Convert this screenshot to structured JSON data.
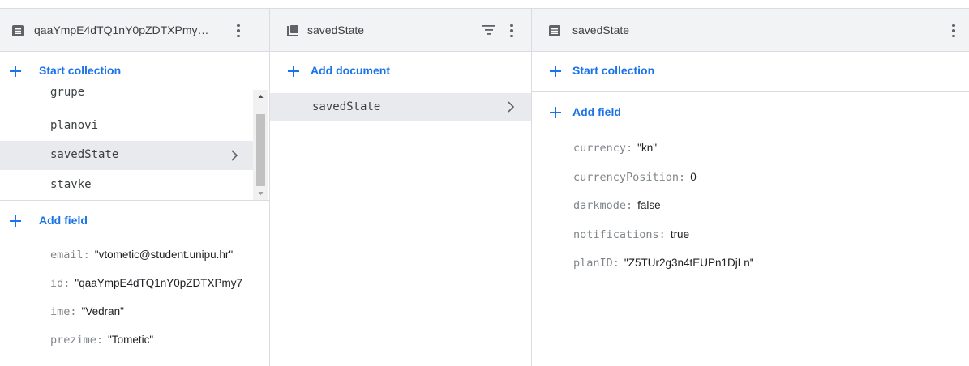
{
  "panel1": {
    "title": "qaaYmpE4dTQ1nY0pZDTXPmy…",
    "start_collection_label": "Start collection",
    "collections": [
      {
        "label": "grupe"
      },
      {
        "label": "planovi"
      },
      {
        "label": "savedState"
      },
      {
        "label": "stavke"
      }
    ],
    "add_field_label": "Add field",
    "fields": [
      {
        "key": "email",
        "value": "\"vtometic@student.unipu.hr\""
      },
      {
        "key": "id",
        "value": "\"qaaYmpE4dTQ1nY0pZDTXPmy7"
      },
      {
        "key": "ime",
        "value": "\"Vedran\""
      },
      {
        "key": "prezime",
        "value": "\"Tometic\""
      }
    ]
  },
  "panel2": {
    "title": "savedState",
    "add_document_label": "Add document",
    "documents": [
      {
        "label": "savedState"
      }
    ]
  },
  "panel3": {
    "title": "savedState",
    "start_collection_label": "Start collection",
    "add_field_label": "Add field",
    "fields": [
      {
        "key": "currency",
        "value": "\"kn\""
      },
      {
        "key": "currencyPosition",
        "value": "0"
      },
      {
        "key": "darkmode",
        "value": "false"
      },
      {
        "key": "notifications",
        "value": "true"
      },
      {
        "key": "planID",
        "value": "\"Z5TUr2g3n4tEUPn1DjLn\""
      }
    ]
  },
  "colors": {
    "accent": "#1a73e8",
    "header_bg": "#f1f3f4",
    "selected_bg": "#e8eaed",
    "border": "#dadce0",
    "key_text": "#80868b"
  },
  "icons": {
    "document": "document-icon",
    "collection": "collection-icon",
    "more": "more-vert-icon",
    "filter": "filter-icon",
    "add": "plus-icon",
    "chevron": "chevron-right-icon"
  }
}
